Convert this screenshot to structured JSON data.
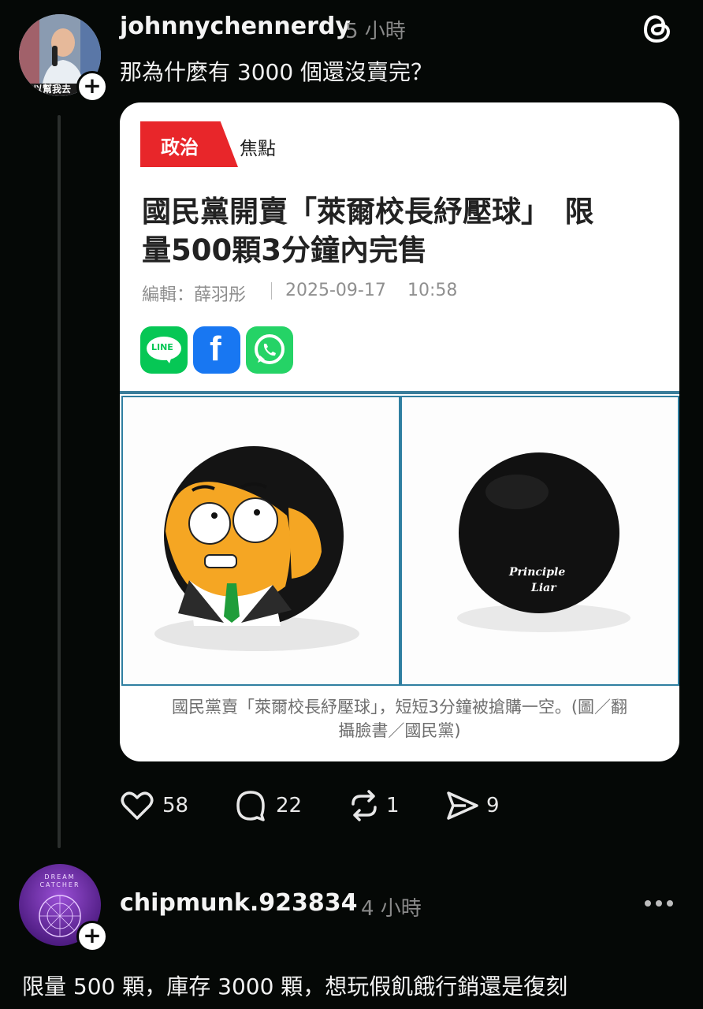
{
  "thread": {
    "author": "johnnychennerdy",
    "time": "5 小時",
    "text": "那為什麼有 3000 個還沒賣完？",
    "avatar_banner": "以幫我去",
    "card": {
      "category": "政治",
      "subcategory": "焦點",
      "headline_line1": "國民黨開賣「萊爾校長紓壓球」　限",
      "headline_line2": "量500顆3分鐘內完售",
      "editor": "編輯：薛羽彤",
      "date": "2025-09-17",
      "clock": "10:58",
      "share": [
        "LINE",
        "f"
      ],
      "ball_text_line1": "Principle",
      "ball_text_line2": "Liar",
      "caption_line1": "國民黨賣「萊爾校長紓壓球」，短短3分鐘被搶購一空。(圖／翻",
      "caption_line2": "攝臉書／國民黨)"
    },
    "actions": {
      "likes": "58",
      "replies": "22",
      "reposts": "1",
      "shares": "9"
    }
  },
  "reply": {
    "author": "chipmunk.923834",
    "time": "4 小時",
    "avatar_text_line1": "DREAM",
    "avatar_text_line2": "CATCHER",
    "text": "限量 500 顆，庫存 3000 顆，想玩假飢餓行銷還是復刻"
  },
  "colors": {
    "background": "#050806",
    "category_red": "#e8262a",
    "line_green": "#06c755",
    "facebook_blue": "#1877f2",
    "whatsapp_green": "#25d366",
    "image_border": "#2f7fa1"
  },
  "icons": [
    "threads-icon",
    "heart-icon",
    "comment-icon",
    "repost-icon",
    "share-icon",
    "more-icon",
    "plus-icon"
  ]
}
